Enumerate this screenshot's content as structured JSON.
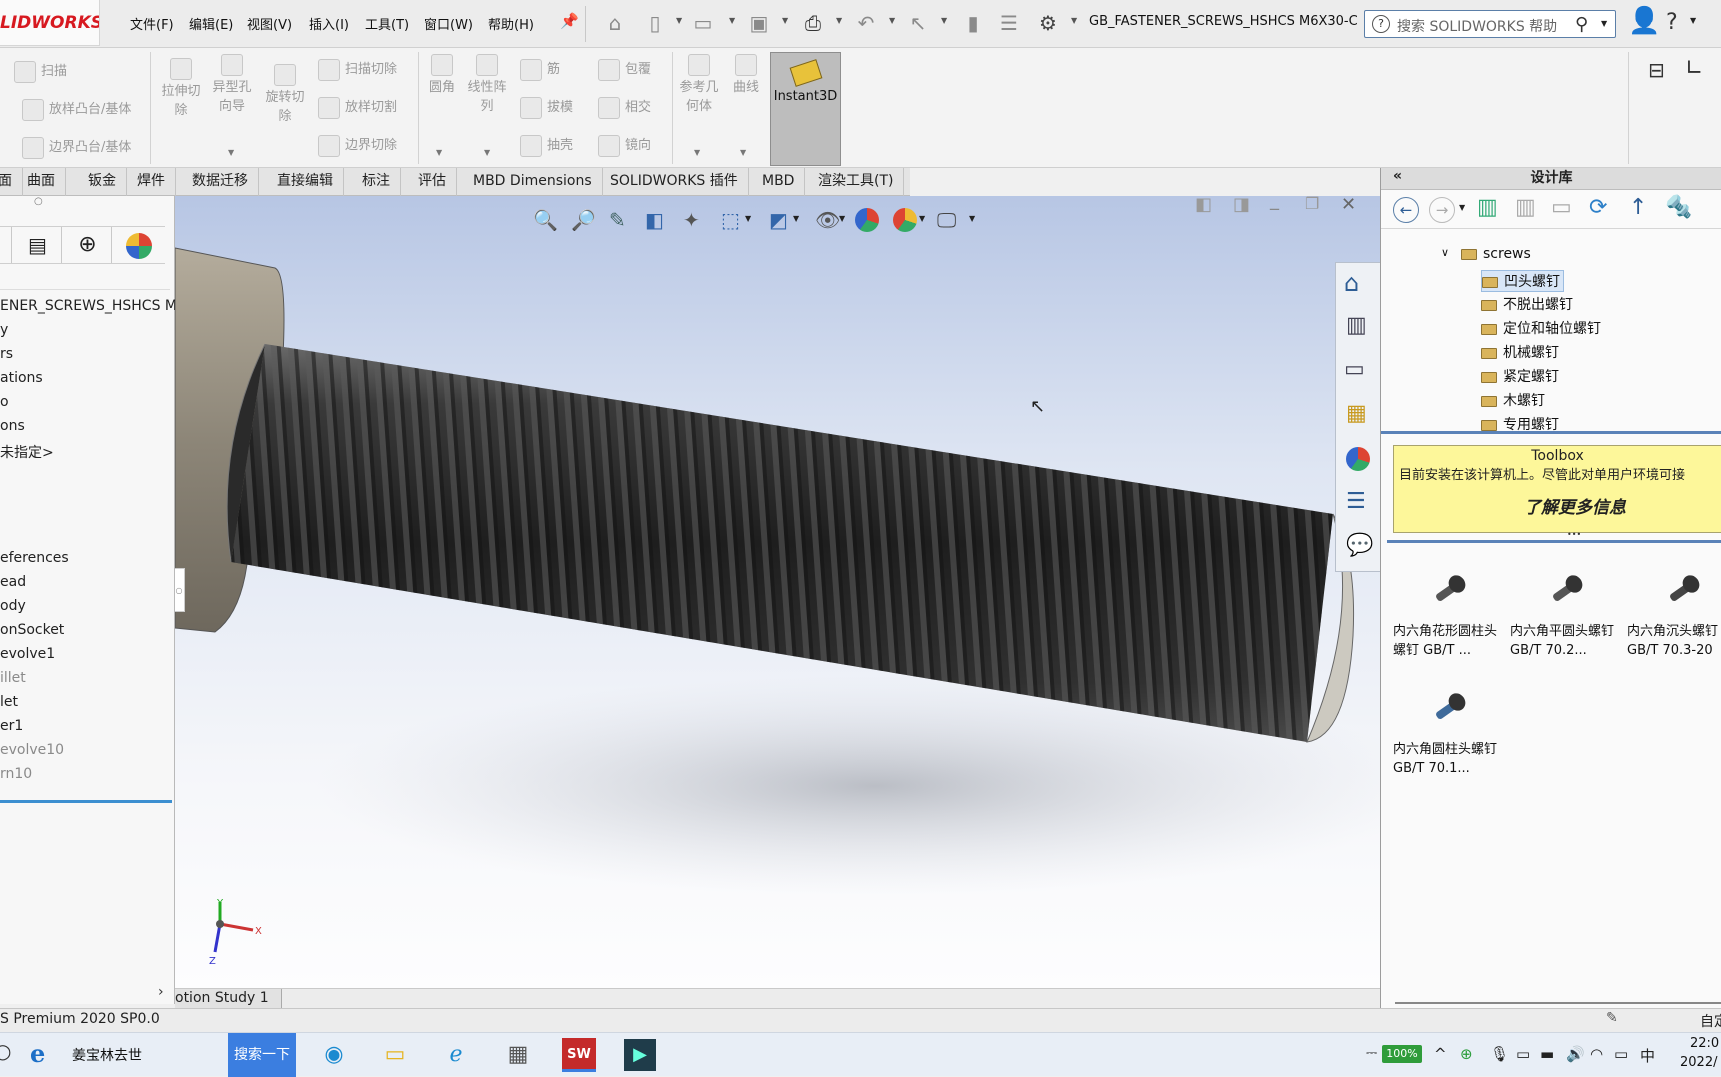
{
  "app": {
    "logo_text": "LIDWORKS",
    "title": "GB_FASTENER_SCREWS_HSHCS M6X30-C ..."
  },
  "menu": [
    "文件(F)",
    "编辑(E)",
    "视图(V)",
    "插入(I)",
    "工具(T)",
    "窗口(W)",
    "帮助(H)"
  ],
  "search": {
    "placeholder": "搜索 SOLIDWORKS 帮助"
  },
  "commands": {
    "col1": [
      "扫描",
      "放样凸台/基体",
      "边界凸台/基体"
    ],
    "big": [
      "拉伸切\n除",
      "异型孔\n向导",
      "旋转切\n除"
    ],
    "col2": [
      "扫描切除",
      "放样切割",
      "边界切除"
    ],
    "col3a": [
      "圆角",
      "线性阵\n列"
    ],
    "col3b": [
      "筋",
      "拔模",
      "抽壳"
    ],
    "col4": [
      "包覆",
      "相交",
      "镜向"
    ],
    "col5": [
      "参考几\n何体",
      "曲线"
    ],
    "instant3d": "Instant3D"
  },
  "tabs": [
    "面",
    "曲面",
    "钣金",
    "焊件",
    "数据迁移",
    "直接编辑",
    "标注",
    "评估",
    "MBD Dimensions",
    "SOLIDWORKS 插件",
    "MBD",
    "渲染工具(T)"
  ],
  "tree": {
    "root": "ENER_SCREWS_HSHCS M",
    "items": [
      "y",
      "rs",
      "ations",
      "o",
      "ons",
      "未指定>",
      "eferences",
      "ead",
      "ody",
      "onSocket",
      "evolve1",
      "illet",
      "let",
      "er1",
      "evolve10",
      "rn10"
    ],
    "dim": [
      false,
      false,
      false,
      false,
      false,
      false,
      false,
      false,
      false,
      false,
      false,
      true,
      false,
      false,
      true,
      true
    ]
  },
  "viewport": {
    "bottom_tab": "otion Study 1"
  },
  "design_library": {
    "title": "设计库",
    "root_folder": "screws",
    "folders": [
      "凹头螺钉",
      "不脱出螺钉",
      "定位和轴位螺钉",
      "机械螺钉",
      "紧定螺钉",
      "木螺钉",
      "专用螺钉"
    ],
    "toolbox": {
      "title": "Toolbox",
      "text": "目前安装在该计算机上。尽管此对单用户环境可接",
      "link": "了解更多信息"
    },
    "parts": [
      {
        "name": "内六角花形圆柱头螺钉 GB/T ..."
      },
      {
        "name": "内六角平圆头螺钉 GB/T 70.2..."
      },
      {
        "name": "内六角沉头螺钉 GB/T 70.3-20"
      },
      {
        "name": "内六角圆柱头螺钉 GB/T 70.1..."
      }
    ]
  },
  "status": {
    "left": "S Premium 2020 SP0.0",
    "right": "自定"
  },
  "taskbar": {
    "app1": "姜宝林去世",
    "search_btn": "搜索一下",
    "battery": "100%",
    "ime": "中",
    "time": "22:0",
    "date": "2022/"
  }
}
